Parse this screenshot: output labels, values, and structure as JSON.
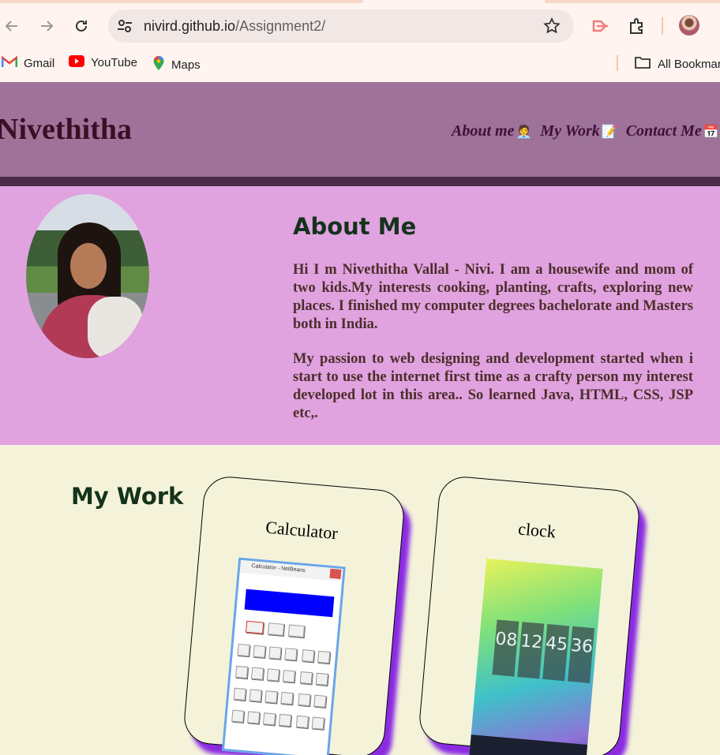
{
  "browser": {
    "url_domain": "nivird.github.io",
    "url_path": "/Assignment2/",
    "bookmarks": [
      {
        "label": "Gmail",
        "icon": "gmail-icon"
      },
      {
        "label": "YouTube",
        "icon": "youtube-icon"
      },
      {
        "label": "Maps",
        "icon": "maps-icon"
      }
    ],
    "all_bookmarks": "All Bookmar"
  },
  "site": {
    "name": "Nivethitha",
    "nav": [
      {
        "label": "About me",
        "emoji": "🧑‍💼"
      },
      {
        "label": "My Work",
        "emoji": "📝"
      },
      {
        "label": "Contact Me",
        "emoji": "📅"
      }
    ]
  },
  "about": {
    "title": "About Me",
    "paragraphs": [
      "Hi I m Nivethitha Vallal - Nivi. I am a housewife and mom of two kids.My interests cooking, planting, crafts, exploring new places. I finished my computer degrees bachelorate and Masters both in India.",
      "My passion to web designing and development started when i start to use the internet first time as a crafty person my interest developed lot in this area.. So learned Java, HTML, CSS, JSP etc,."
    ]
  },
  "work": {
    "title": "My Work",
    "cards": [
      {
        "title": "Calculator",
        "window_title": "Calculator - NetBeans"
      },
      {
        "title": "clock",
        "digits": [
          "08",
          "12",
          "45",
          "36"
        ]
      }
    ]
  },
  "colors": {
    "header": "#9f7399",
    "about_bg": "#e1a2e0",
    "page_bg": "#f4f3da",
    "card_shadow": "#8a2be2"
  }
}
